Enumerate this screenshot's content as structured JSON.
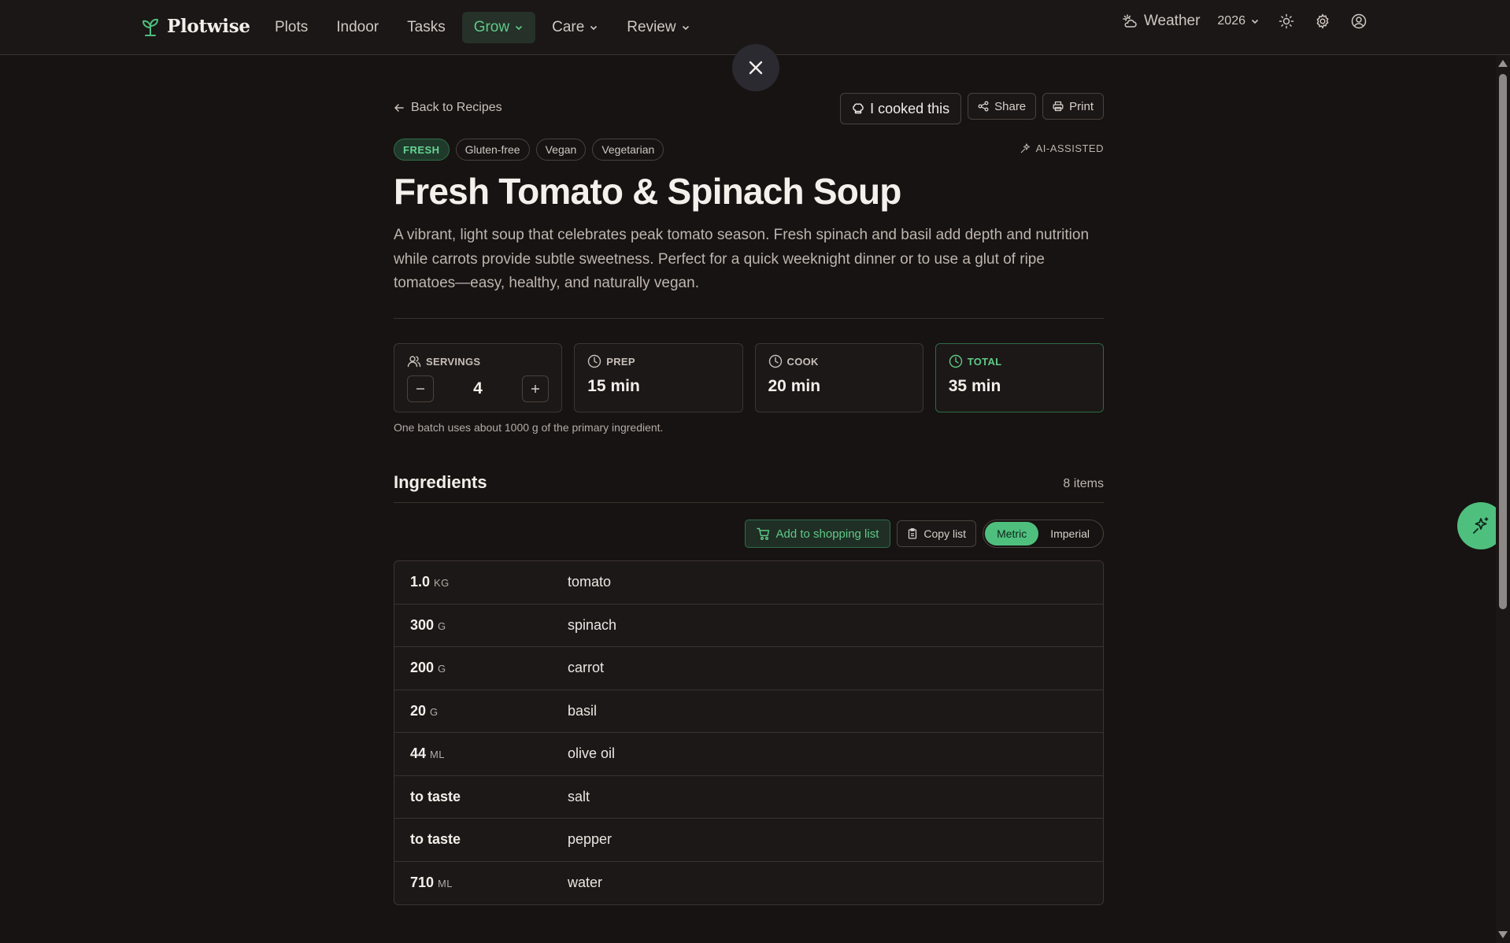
{
  "nav": {
    "brand": "Plotwise",
    "links": [
      {
        "label": "Plots"
      },
      {
        "label": "Indoor"
      },
      {
        "label": "Tasks"
      },
      {
        "label": "Grow"
      },
      {
        "label": "Care"
      },
      {
        "label": "Review"
      }
    ],
    "weather_label": "Weather",
    "year": "2026"
  },
  "recipe": {
    "back_label": "Back to Recipes",
    "cooked_label": "I cooked this",
    "share_label": "Share",
    "print_label": "Print",
    "badges": [
      "FRESH",
      "Gluten-free",
      "Vegan",
      "Vegetarian"
    ],
    "ai_label": "AI-ASSISTED",
    "title": "Fresh Tomato & Spinach Soup",
    "description": "A vibrant, light soup that celebrates peak tomato season. Fresh spinach and basil add depth and nutrition while carrots provide subtle sweetness. Perfect for a quick weeknight dinner or to use a glut of ripe tomatoes—easy, healthy, and naturally vegan.",
    "stats": {
      "servings_label": "SERVINGS",
      "servings_value": "4",
      "prep_label": "PREP",
      "prep_value": "15 min",
      "cook_label": "COOK",
      "cook_value": "20 min",
      "total_label": "TOTAL",
      "total_value": "35 min"
    },
    "batch_note": "One batch uses about 1000 g of the primary ingredient."
  },
  "ingredients": {
    "title": "Ingredients",
    "count": "8 items",
    "add_shopping_label": "Add to shopping list",
    "copy_label": "Copy list",
    "unit_metric": "Metric",
    "unit_imperial": "Imperial",
    "items": [
      {
        "qty": "1.0",
        "unit": "KG",
        "name": "tomato"
      },
      {
        "qty": "300",
        "unit": "G",
        "name": "spinach"
      },
      {
        "qty": "200",
        "unit": "G",
        "name": "carrot"
      },
      {
        "qty": "20",
        "unit": "G",
        "name": "basil"
      },
      {
        "qty": "44",
        "unit": "ML",
        "name": "olive oil"
      },
      {
        "qty": "to taste",
        "unit": "",
        "name": "salt"
      },
      {
        "qty": "to taste",
        "unit": "",
        "name": "pepper"
      },
      {
        "qty": "710",
        "unit": "ML",
        "name": "water"
      }
    ]
  },
  "colors": {
    "accent": "#4fbf7e",
    "background": "#171312",
    "surface": "#1c1817"
  }
}
